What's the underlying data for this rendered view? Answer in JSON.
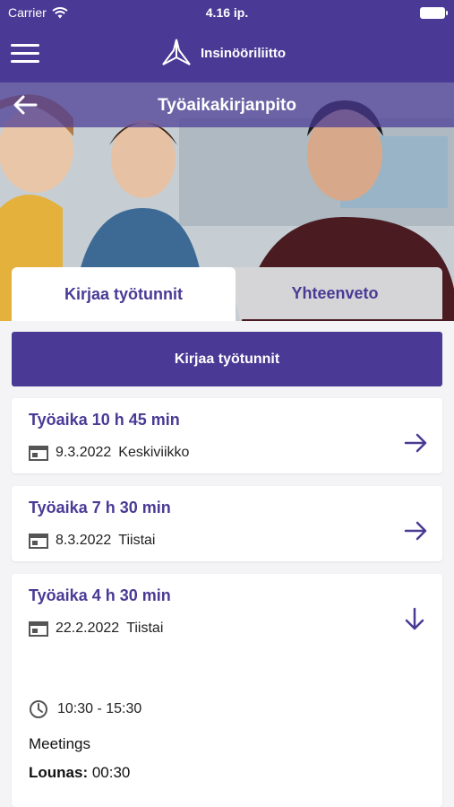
{
  "status": {
    "carrier": "Carrier",
    "time": "4.16 ip."
  },
  "app": {
    "brand": "Insinööriliitto"
  },
  "page": {
    "title": "Työaikakirjanpito"
  },
  "tabs": {
    "active": "Kirjaa työtunnit",
    "inactive": "Yhteenveto"
  },
  "cta": {
    "label": "Kirjaa työtunnit"
  },
  "entries": [
    {
      "title": "Työaika 10 h 45 min",
      "date": "9.3.2022",
      "day": "Keskiviikko"
    },
    {
      "title": "Työaika 7 h 30 min",
      "date": "8.3.2022",
      "day": "Tiistai"
    },
    {
      "title": "Työaika 4 h 30 min",
      "date": "22.2.2022",
      "day": "Tiistai",
      "time_range": "10:30 - 15:30",
      "description": "Meetings",
      "lunch_label": "Lounas:",
      "lunch_value": "00:30"
    }
  ],
  "colors": {
    "brand": "#4a3a95",
    "tab_inactive": "#d5d5d7",
    "background": "#f4f4f6"
  }
}
